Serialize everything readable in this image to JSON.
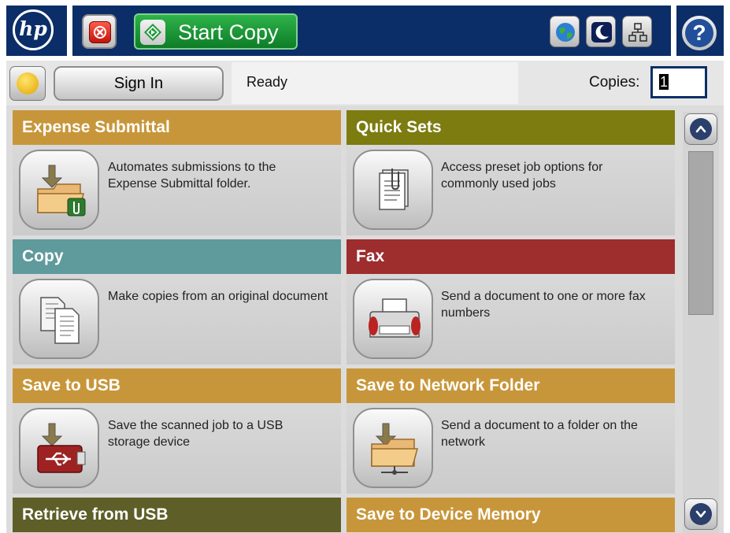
{
  "topbar": {
    "logo_text": "hp",
    "stop_icon": "stop-icon",
    "start_copy_label": "Start Copy",
    "start_icon": "start-diamond-icon",
    "globe_icon": "globe-icon",
    "sleep_icon": "sleep-moon-icon",
    "network_icon": "network-icon",
    "help_label": "?"
  },
  "status": {
    "home_icon": "home-icon",
    "sign_in_label": "Sign In",
    "status_text": "Ready",
    "copies_label": "Copies:",
    "copies_value": "1"
  },
  "tiles": [
    {
      "title": "Expense Submittal",
      "desc": "Automates submissions to the Expense Submittal folder.",
      "color": "#c8963a",
      "icon": "folder-clip-icon"
    },
    {
      "title": "Quick Sets",
      "desc": "Access preset job options for commonly used jobs",
      "color": "#7c7c10",
      "icon": "document-icon"
    },
    {
      "title": "Copy",
      "desc": "Make copies from an original document",
      "color": "#5f9a9c",
      "icon": "copy-icon"
    },
    {
      "title": "Fax",
      "desc": "Send a document to one or more fax numbers",
      "color": "#9e2d2d",
      "icon": "fax-icon"
    },
    {
      "title": "Save to USB",
      "desc": "Save the scanned job to a USB storage device",
      "color": "#c8963a",
      "icon": "usb-icon"
    },
    {
      "title": "Save to Network Folder",
      "desc": "Send a document to a folder on the network",
      "color": "#c8963a",
      "icon": "network-folder-icon"
    },
    {
      "title": "Retrieve from USB",
      "desc": "",
      "color": "#5e5e28",
      "icon": ""
    },
    {
      "title": "Save to Device Memory",
      "desc": "",
      "color": "#c8963a",
      "icon": ""
    }
  ],
  "scrollbar": {
    "up_icon": "scroll-up-icon",
    "down_icon": "scroll-down-icon"
  }
}
